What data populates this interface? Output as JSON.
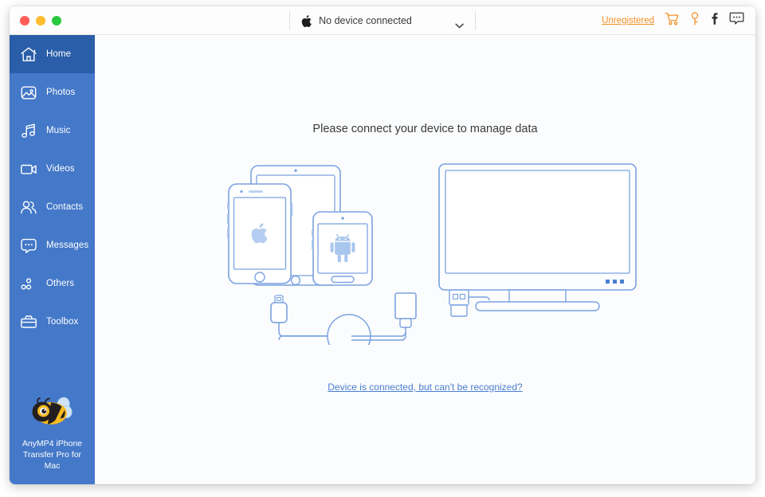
{
  "window": {
    "traffic_lights": [
      {
        "name": "close",
        "color": "#ff5f57"
      },
      {
        "name": "minimize",
        "color": "#febc2e"
      },
      {
        "name": "maximize",
        "color": "#28c840"
      }
    ]
  },
  "titlebar": {
    "device_selector": {
      "icon": "apple-logo-icon",
      "status_text": "No device connected",
      "chevron": "chevron-down-icon"
    },
    "right_actions": {
      "unregistered_label": "Unregistered",
      "icons": [
        {
          "name": "cart-icon",
          "title": "Buy"
        },
        {
          "name": "key-icon",
          "title": "Register"
        },
        {
          "name": "facebook-icon",
          "title": "Facebook"
        },
        {
          "name": "feedback-icon",
          "title": "Feedback"
        }
      ]
    }
  },
  "sidebar": {
    "accent_color": "#4478c8",
    "active_color": "#2a5ea8",
    "items": [
      {
        "label": "Home",
        "icon": "home-icon",
        "active": true
      },
      {
        "label": "Photos",
        "icon": "photos-icon",
        "active": false
      },
      {
        "label": "Music",
        "icon": "music-icon",
        "active": false
      },
      {
        "label": "Videos",
        "icon": "videos-icon",
        "active": false
      },
      {
        "label": "Contacts",
        "icon": "contacts-icon",
        "active": false
      },
      {
        "label": "Messages",
        "icon": "messages-icon",
        "active": false
      },
      {
        "label": "Others",
        "icon": "others-icon",
        "active": false
      },
      {
        "label": "Toolbox",
        "icon": "toolbox-icon",
        "active": false
      }
    ],
    "brand": {
      "logo": "bee-logo-icon",
      "name": "AnyMP4 iPhone Transfer Pro for Mac"
    }
  },
  "main": {
    "heading": "Please connect your device to manage data",
    "illustration": {
      "name": "devices-connect-illustration",
      "line_color": "#7ba2e0",
      "parts": [
        "tablet",
        "iphone",
        "android-phone",
        "monitor",
        "usb-cable",
        "lightning-connector",
        "usb-connector"
      ]
    },
    "help_link": "Device is connected, but can't be recognized?"
  }
}
